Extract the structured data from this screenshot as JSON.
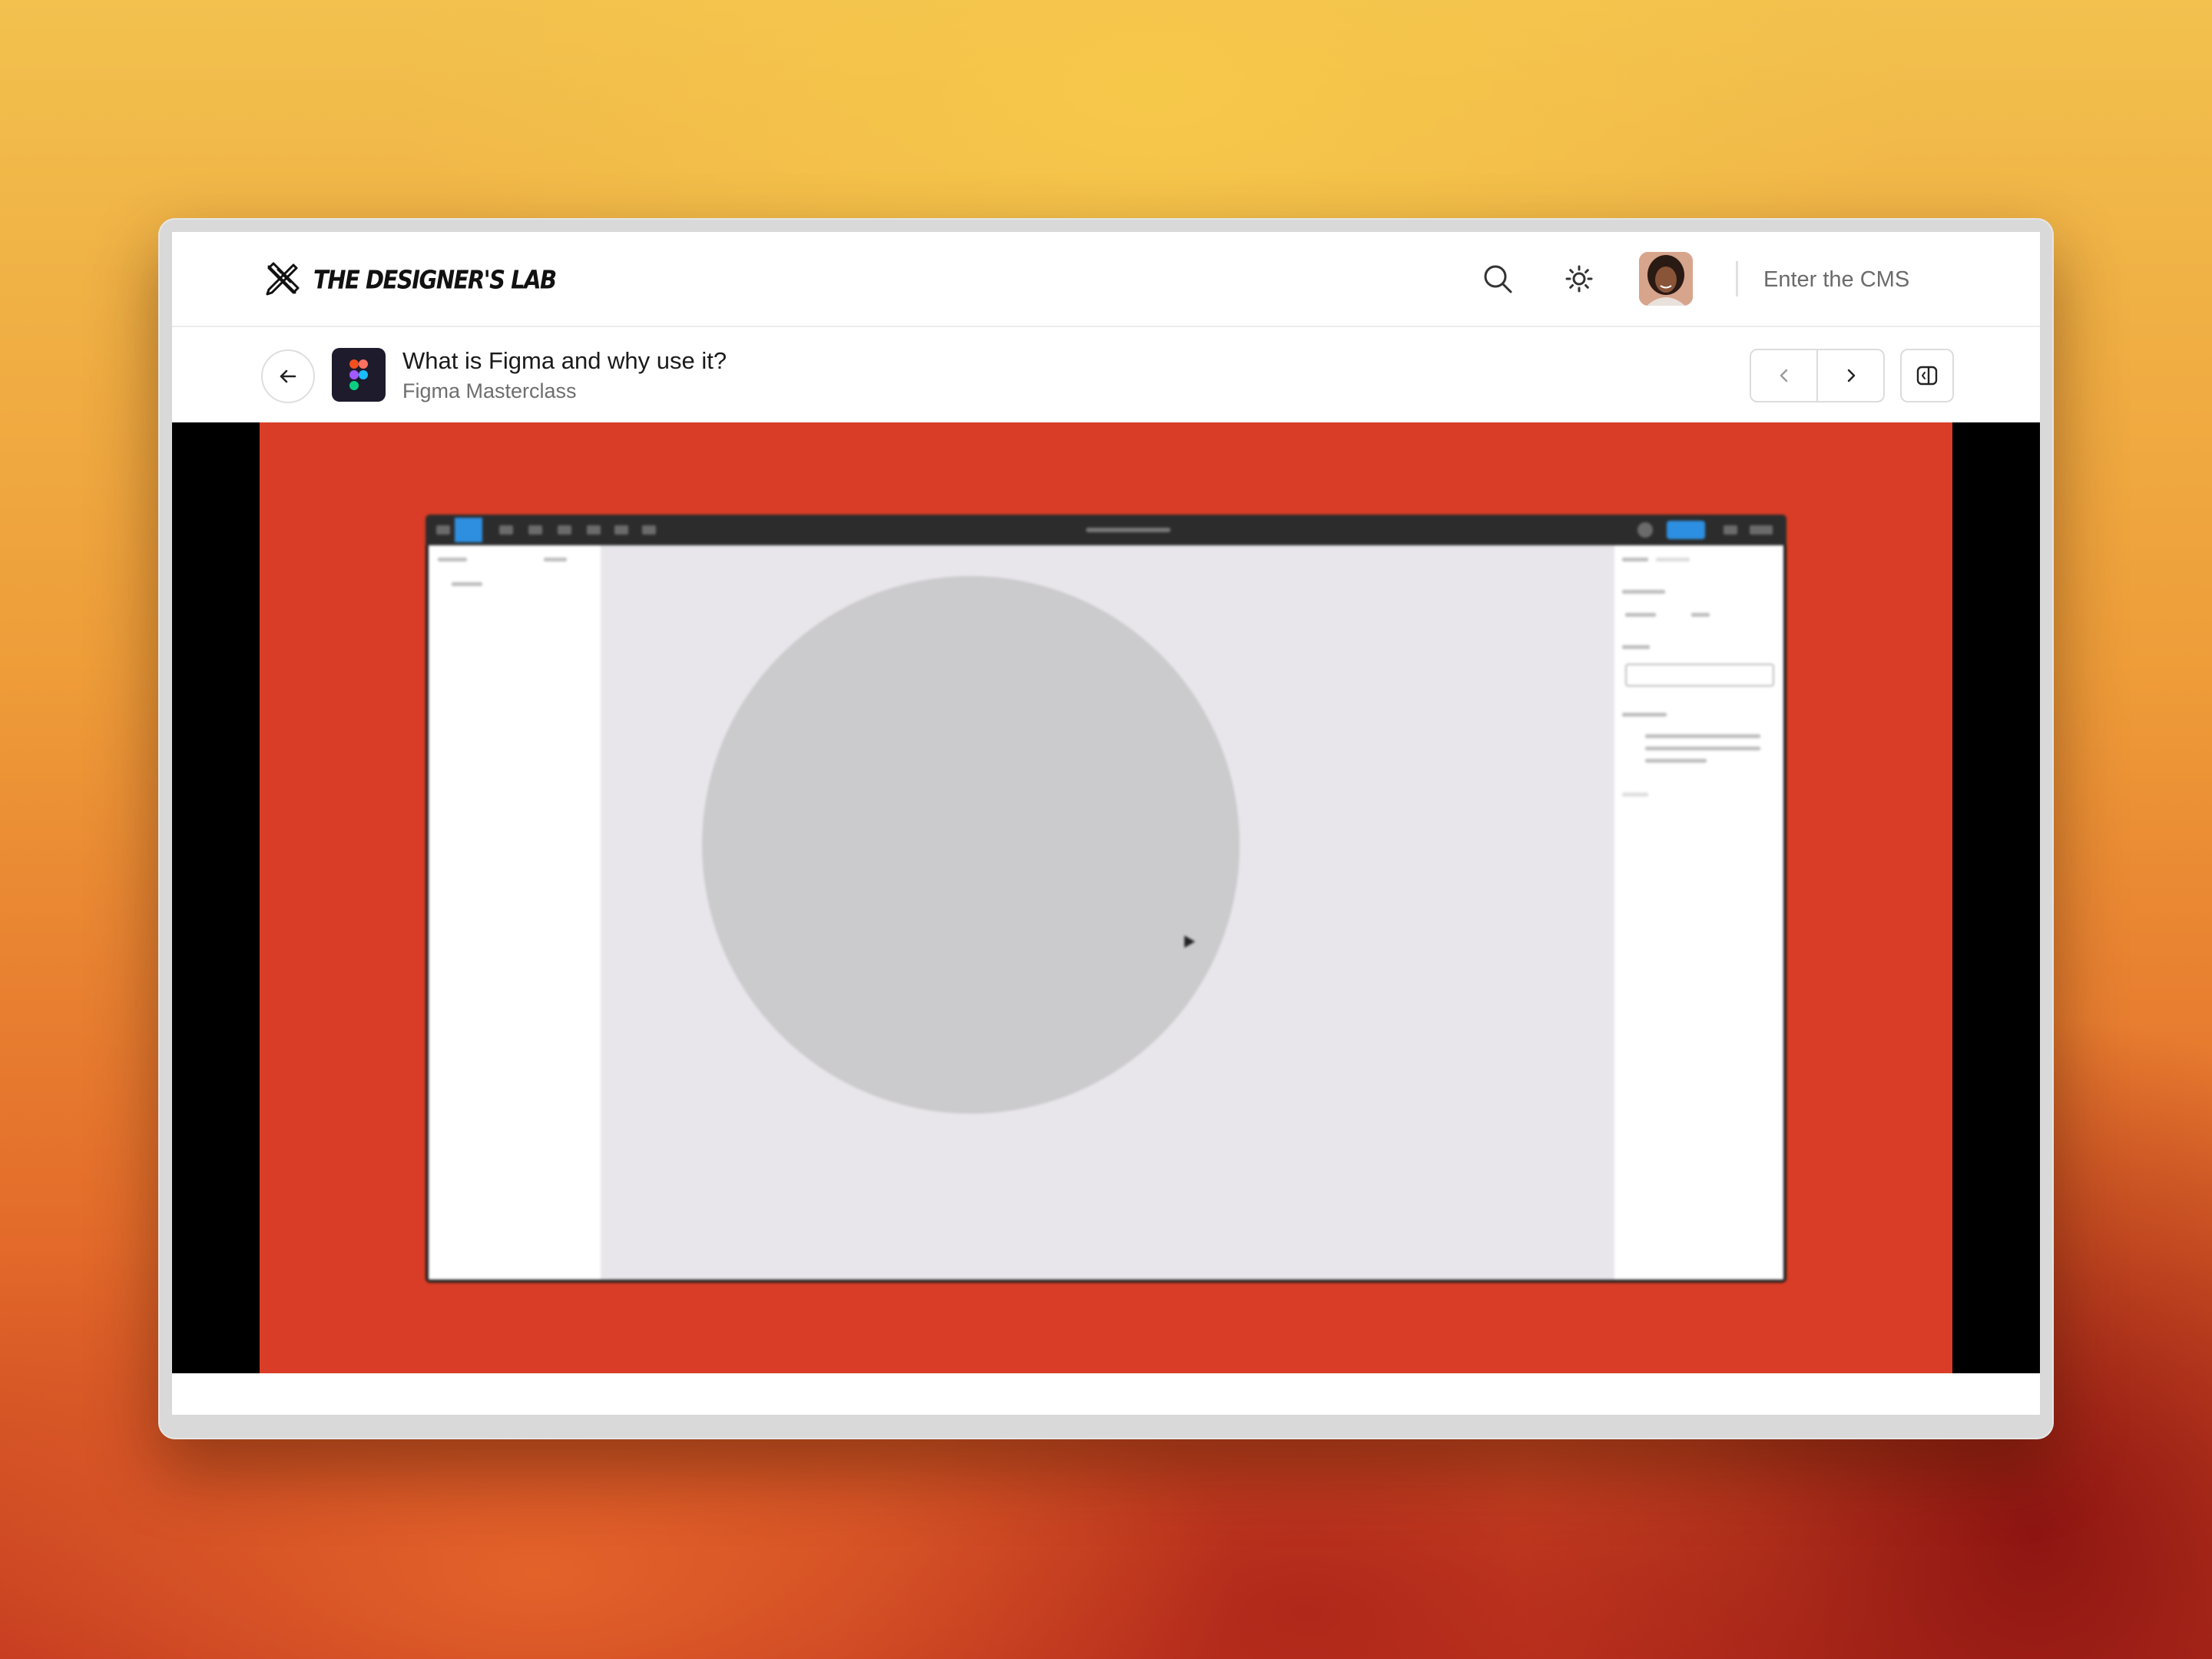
{
  "brand": {
    "name": "The Designer's Lab"
  },
  "header": {
    "search_icon": "search-icon",
    "theme_icon": "sun-icon",
    "cms_label": "Enter the CMS"
  },
  "lesson": {
    "title": "What is Figma and why use it?",
    "course": "Figma Masterclass",
    "back_icon": "arrow-left-icon",
    "prev_icon": "chevron-left-icon",
    "next_icon": "chevron-right-icon",
    "panel_icon": "sidebar-toggle-icon"
  },
  "video": {
    "background_color": "#d93d27",
    "content": "Blurred Figma editor screenshot with a grey circle on the canvas"
  }
}
